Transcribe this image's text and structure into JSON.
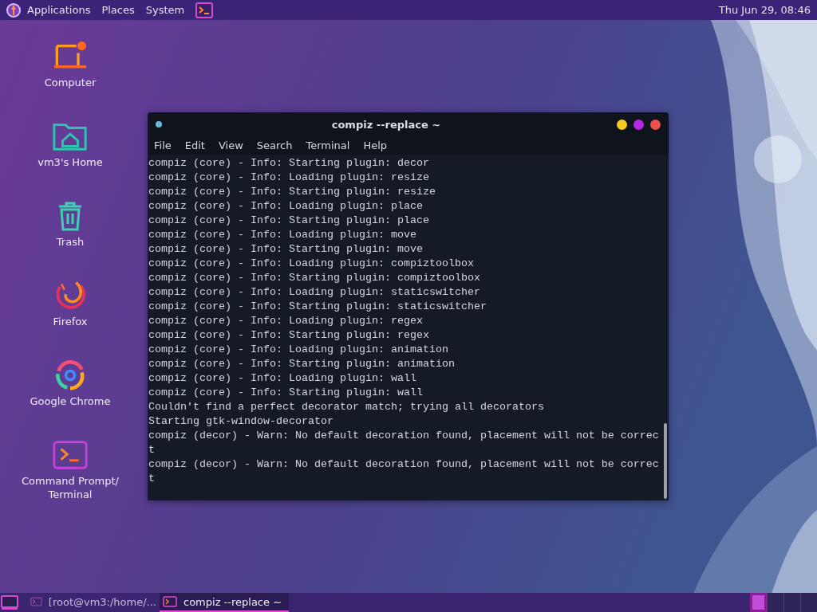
{
  "top_panel": {
    "menus": [
      {
        "label": "Applications"
      },
      {
        "label": "Places"
      },
      {
        "label": "System"
      }
    ],
    "clock": "Thu Jun 29, 08:46"
  },
  "desktop_icons": [
    {
      "kind": "computer",
      "label": "Computer"
    },
    {
      "kind": "home",
      "label": "vm3's Home"
    },
    {
      "kind": "trash",
      "label": "Trash"
    },
    {
      "kind": "firefox",
      "label": "Firefox"
    },
    {
      "kind": "chrome",
      "label": "Google Chrome"
    },
    {
      "kind": "terminal",
      "label": "Command Prompt/ Terminal"
    }
  ],
  "window": {
    "title": "compiz --replace ~",
    "menu": [
      "File",
      "Edit",
      "View",
      "Search",
      "Terminal",
      "Help"
    ],
    "lines": [
      "compiz (core) - Info: Starting plugin: decor",
      "compiz (core) - Info: Loading plugin: resize",
      "compiz (core) - Info: Starting plugin: resize",
      "compiz (core) - Info: Loading plugin: place",
      "compiz (core) - Info: Starting plugin: place",
      "compiz (core) - Info: Loading plugin: move",
      "compiz (core) - Info: Starting plugin: move",
      "compiz (core) - Info: Loading plugin: compiztoolbox",
      "compiz (core) - Info: Starting plugin: compiztoolbox",
      "compiz (core) - Info: Loading plugin: staticswitcher",
      "compiz (core) - Info: Starting plugin: staticswitcher",
      "compiz (core) - Info: Loading plugin: regex",
      "compiz (core) - Info: Starting plugin: regex",
      "compiz (core) - Info: Loading plugin: animation",
      "compiz (core) - Info: Starting plugin: animation",
      "compiz (core) - Info: Loading plugin: wall",
      "compiz (core) - Info: Starting plugin: wall",
      "Couldn't find a perfect decorator match; trying all decorators",
      "Starting gtk-window-decorator",
      "compiz (decor) - Warn: No default decoration found, placement will not be correc",
      "t",
      "compiz (decor) - Warn: No default decoration found, placement will not be correc",
      "t"
    ]
  },
  "taskbar": {
    "tasks": [
      {
        "label": "[root@vm3:/home/...",
        "selected": false
      },
      {
        "label": "compiz --replace ~",
        "selected": true
      }
    ],
    "workspaces": [
      {
        "selected": true
      },
      {
        "selected": false
      },
      {
        "selected": false
      },
      {
        "selected": false
      }
    ]
  }
}
